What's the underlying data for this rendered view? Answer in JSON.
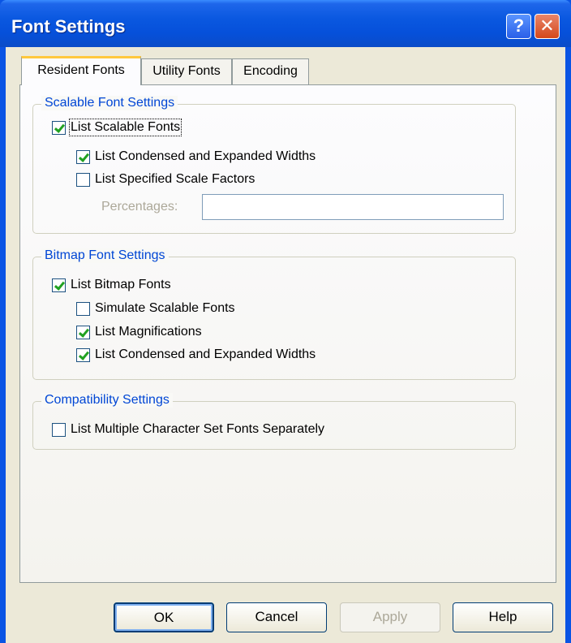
{
  "window": {
    "title": "Font Settings"
  },
  "titlebar_buttons": {
    "help": "?",
    "close": "✕"
  },
  "tabs": [
    {
      "label": "Resident Fonts",
      "active": true
    },
    {
      "label": "Utility Fonts",
      "active": false
    },
    {
      "label": "Encoding",
      "active": false
    }
  ],
  "scalable": {
    "legend": "Scalable Font Settings",
    "list_scalable": {
      "label": "List Scalable Fonts",
      "checked": true
    },
    "condensed": {
      "label": "List Condensed and Expanded Widths",
      "checked": true
    },
    "scale_factors": {
      "label": "List Specified Scale Factors",
      "checked": false
    },
    "percentages": {
      "label": "Percentages:",
      "value": ""
    }
  },
  "bitmap": {
    "legend": "Bitmap Font Settings",
    "list_bitmap": {
      "label": "List Bitmap Fonts",
      "checked": true
    },
    "simulate": {
      "label": "Simulate Scalable Fonts",
      "checked": false
    },
    "magnifications": {
      "label": "List Magnifications",
      "checked": true
    },
    "condensed": {
      "label": "List Condensed and Expanded Widths",
      "checked": true
    }
  },
  "compat": {
    "legend": "Compatibility Settings",
    "multiple_charset": {
      "label": "List Multiple Character Set Fonts Separately",
      "checked": false
    }
  },
  "buttons": {
    "ok": "OK",
    "cancel": "Cancel",
    "apply": "Apply",
    "help": "Help"
  },
  "colors": {
    "title_bar": "#0a58e0",
    "group_label": "#0046d5",
    "checkmark": "#21a121",
    "dialog_bg": "#ece9d8"
  }
}
